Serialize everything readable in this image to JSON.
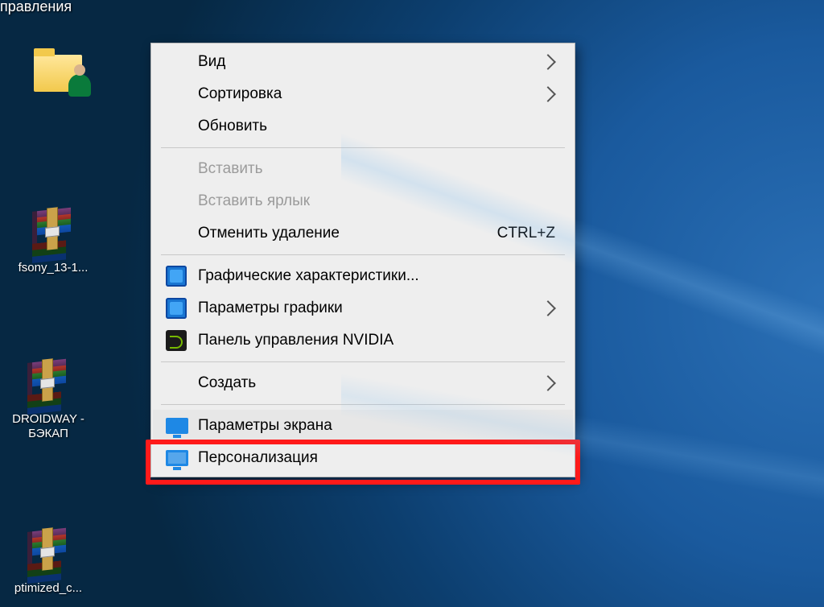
{
  "truncated_top_label": "правления",
  "desktop_icons": {
    "folder_user": {
      "label": ""
    },
    "rar1": {
      "label": "fsony_13-1..."
    },
    "rar2": {
      "label": "DROIDWAY - БЭКАП"
    },
    "rar3": {
      "label": "ptimized_c..."
    }
  },
  "context_menu": {
    "view": {
      "label": "Вид"
    },
    "sort": {
      "label": "Сортировка"
    },
    "refresh": {
      "label": "Обновить"
    },
    "paste": {
      "label": "Вставить"
    },
    "paste_shortcut": {
      "label": "Вставить ярлык"
    },
    "undo_delete": {
      "label": "Отменить удаление",
      "shortcut": "CTRL+Z"
    },
    "intel_gfx": {
      "label": "Графические характеристики..."
    },
    "intel_params": {
      "label": "Параметры графики"
    },
    "nvidia": {
      "label": "Панель управления NVIDIA"
    },
    "new": {
      "label": "Создать"
    },
    "display": {
      "label": "Параметры экрана"
    },
    "personalize": {
      "label": "Персонализация"
    }
  }
}
